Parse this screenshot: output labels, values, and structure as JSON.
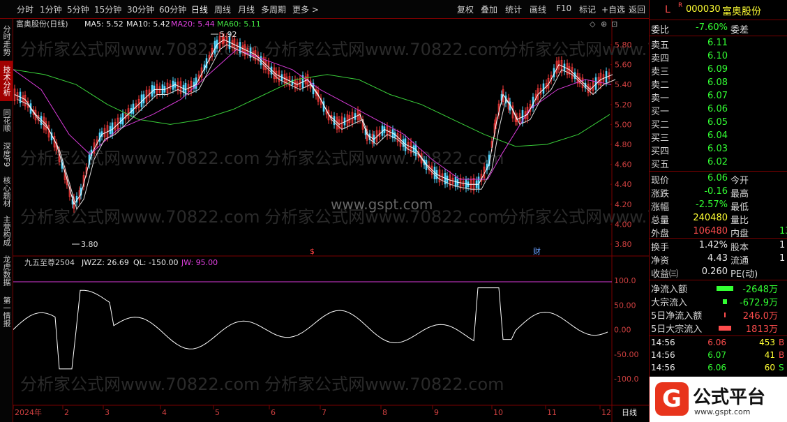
{
  "toolbar": {
    "items": [
      "分时",
      "1分钟",
      "5分钟",
      "15分钟",
      "30分钟",
      "60分钟",
      "日线",
      "周线",
      "月线",
      "多周期",
      "更多 >"
    ],
    "right": [
      "复权",
      "叠加",
      "统计",
      "画线",
      "F10",
      "标记",
      "+自选",
      "返回"
    ]
  },
  "left_tabs": [
    "分时走势",
    "技术分析",
    "同花顺",
    "深度F9",
    "核心题材",
    "主营构成",
    "龙虎数据",
    "第一情报"
  ],
  "main_chart": {
    "legend_title": "富奥股份(日线)",
    "ma5": "MA5: 5.52",
    "ma10": "MA10: 5.42",
    "ma20": "MA20: 5.44",
    "ma60": "MA60: 5.11",
    "y_ticks": [
      "5.80",
      "5.60",
      "5.40",
      "5.20",
      "5.00",
      "4.80",
      "4.60",
      "4.40",
      "4.20",
      "4.00",
      "3.80"
    ],
    "high_label": "5.92",
    "low_label": "3.80",
    "markers": [
      "$",
      "财"
    ],
    "watermark": "www.gspt.com",
    "bg_watermark": "分析家公式网www.70822.com"
  },
  "indicator": {
    "title": "九五至尊2504",
    "jwzz": "JWZZ: 26.69",
    "ql": "QL: -150.00",
    "jw": "JW: 95.00",
    "y_ticks": [
      "100.0",
      "50.00",
      "0.00",
      "-50.00",
      "-100.0"
    ]
  },
  "x_axis": {
    "labels": [
      "2024年",
      "2",
      "3",
      "4",
      "5",
      "6",
      "7",
      "8",
      "9",
      "10",
      "11",
      "12"
    ],
    "period": "日线"
  },
  "quote": {
    "badge": "L",
    "r": "R",
    "code": "000030",
    "name": "富奥股份",
    "weibi_label": "委比",
    "weibi": "-7.60%",
    "weicha": "委差",
    "sell": [
      {
        "l": "卖五",
        "p": "6.11"
      },
      {
        "l": "卖四",
        "p": "6.10"
      },
      {
        "l": "卖三",
        "p": "6.09"
      },
      {
        "l": "卖二",
        "p": "6.08"
      },
      {
        "l": "卖一",
        "p": "6.07"
      }
    ],
    "buy": [
      {
        "l": "买一",
        "p": "6.06"
      },
      {
        "l": "买二",
        "p": "6.05"
      },
      {
        "l": "买三",
        "p": "6.04"
      },
      {
        "l": "买四",
        "p": "6.03"
      },
      {
        "l": "买五",
        "p": "6.02"
      }
    ],
    "stats": [
      {
        "l": "现价",
        "v": "6.06",
        "r": "今开"
      },
      {
        "l": "涨跌",
        "v": "-0.16",
        "r": "最高"
      },
      {
        "l": "涨幅",
        "v": "-2.57%",
        "r": "最低"
      },
      {
        "l": "总量",
        "v": "240480",
        "r": "量比"
      },
      {
        "l": "外盘",
        "v": "106480",
        "r": "内盘",
        "x": "13"
      }
    ],
    "stats2": [
      {
        "l": "换手",
        "v": "1.42%",
        "r": "股本",
        "x": "1"
      },
      {
        "l": "净资",
        "v": "4.43",
        "r": "流通",
        "x": "1"
      },
      {
        "l": "收益㈢",
        "v": "0.260",
        "r": "PE(动)"
      }
    ],
    "flow": [
      {
        "l": "净流入额",
        "v": "-2648万"
      },
      {
        "l": "大宗流入",
        "v": "-672.9万"
      },
      {
        "l": "5日净流入额",
        "v": "246.0万"
      },
      {
        "l": "5日大宗流入",
        "v": "1813万"
      }
    ],
    "ticks": [
      {
        "t": "14:56",
        "p": "6.06",
        "v": "453",
        "s": "B"
      },
      {
        "t": "14:56",
        "p": "6.07",
        "v": "41",
        "s": "B"
      },
      {
        "t": "14:56",
        "p": "6.06",
        "v": "60",
        "s": "S"
      },
      {
        "t": "14:56",
        "p": "6.06",
        "v": "",
        "s": ""
      }
    ]
  },
  "logo": {
    "text": "公式平台",
    "url": "www.gspt.com"
  },
  "chart_data": {
    "type": "line",
    "note": "",
    "x_range": [
      "2024-01",
      "2024-12"
    ],
    "series": [
      {
        "name": "MA60",
        "values": [
          5.55,
          5.5,
          5.4,
          5.2,
          5.05,
          5.0,
          5.05,
          5.15,
          5.3,
          5.45,
          5.5,
          5.45,
          5.3,
          5.2,
          5.05,
          4.9,
          4.78,
          4.8,
          4.9,
          5.1
        ]
      },
      {
        "name": "JWZZ",
        "values": [
          -30,
          -50,
          -90,
          60,
          80,
          40,
          10,
          30,
          -10,
          -20,
          20,
          -30,
          -40,
          -20,
          -30,
          -20,
          10,
          100,
          -10,
          20
        ]
      }
    ]
  }
}
